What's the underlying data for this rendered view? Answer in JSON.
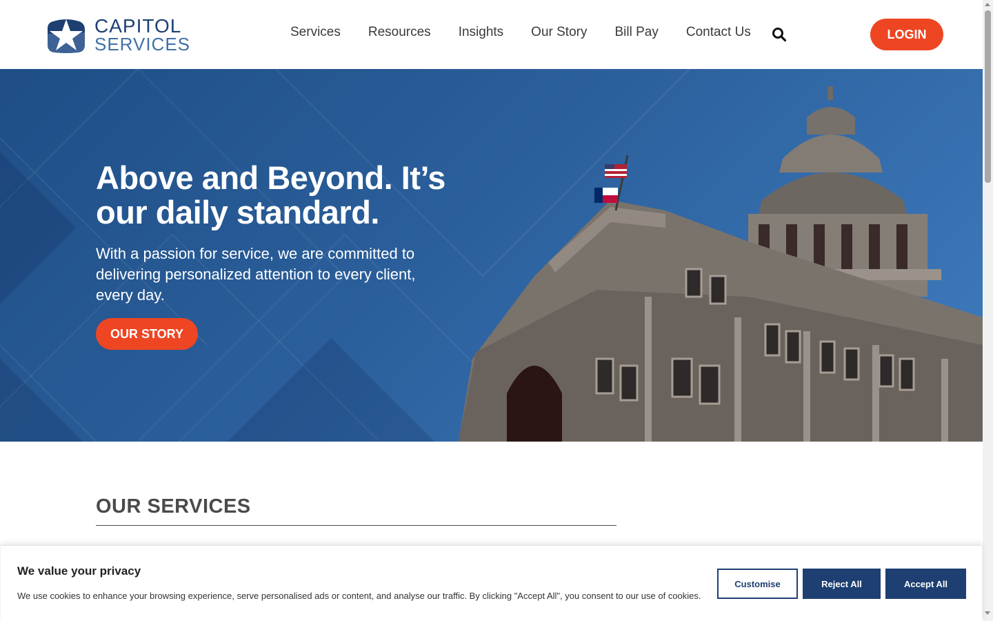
{
  "brand": {
    "line1": "CAPITOL",
    "line2": "SERVICES",
    "primary_color": "#1d3f72",
    "accent_color": "#ee4523"
  },
  "nav": {
    "items": [
      "Services",
      "Resources",
      "Insights",
      "Our Story",
      "Bill Pay",
      "Contact Us"
    ],
    "search_icon": "search-icon",
    "login_label": "LOGIN"
  },
  "hero": {
    "title": "Above and Beyond. It’s our daily standard.",
    "subtitle": "With a passion for service, we are committed to delivering personalized attention to every client, every day.",
    "cta_label": "OUR STORY"
  },
  "services": {
    "heading": "OUR SERVICES"
  },
  "cookie": {
    "title": "We value your privacy",
    "text": "We use cookies to enhance your browsing experience, serve personalised ads or content, and analyse our traffic. By clicking \"Accept All\", you consent to our use of cookies.",
    "customise_label": "Customise",
    "reject_label": "Reject All",
    "accept_label": "Accept All"
  }
}
